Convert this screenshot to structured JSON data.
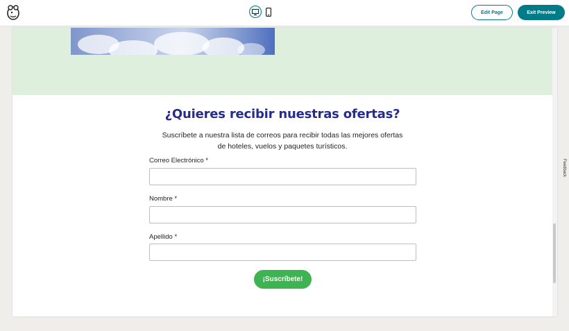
{
  "topbar": {
    "logo_icon": "mailchimp-logo-icon",
    "desktop_icon": "desktop-monitor-icon",
    "mobile_icon": "mobile-phone-icon",
    "edit_label": "Edit Page",
    "exit_label": "Exit Preview"
  },
  "page": {
    "title": "¿Quieres recibir nuestras ofertas?",
    "subtitle_line1": "Suscríbete a nuestra lista de correos para recibir todas las mejores ofertas",
    "subtitle_line2": "de hoteles, vuelos y paquetes turísticos.",
    "fields": [
      {
        "label": "Correo Electrónico *",
        "value": "",
        "placeholder": ""
      },
      {
        "label": "Nombre *",
        "value": "",
        "placeholder": ""
      },
      {
        "label": "Apellido *",
        "value": "",
        "placeholder": ""
      }
    ],
    "submit_label": "¡Suscríbete!"
  },
  "feedback_label": "Feedback",
  "colors": {
    "accent": "#007c89",
    "title": "#252c8c",
    "submit": "#3db352",
    "band": "#deefdd"
  }
}
